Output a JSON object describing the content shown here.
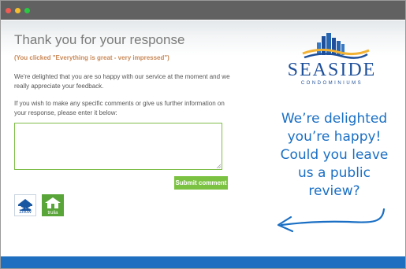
{
  "window": {
    "controls": [
      "close",
      "minimize",
      "maximize"
    ]
  },
  "page": {
    "title": "Thank you for your response",
    "clicked_note": "(You clicked \"Everything is great - very impressed\")",
    "paragraph1": "We're delighted that you are so happy with our service at the moment and we really appreciate your feedback.",
    "paragraph2": "If you wish to make any specific comments or give us further information on your response, please enter it below:",
    "comment_value": "",
    "submit_label": "Submit comment"
  },
  "review_sites": [
    {
      "name": "Zillow",
      "icon": "zillow-icon"
    },
    {
      "name": "trulia",
      "icon": "trulia-icon"
    }
  ],
  "brand": {
    "name": "SEASIDE",
    "subtitle": "CONDOMINIUMS"
  },
  "promo": {
    "line1": "We’re delighted",
    "line2": "you’re happy!",
    "line3": "Could you leave",
    "line4": "us a public review?"
  },
  "colors": {
    "accent_green": "#7cc242",
    "brand_blue": "#1e4f9a",
    "footer_blue": "#1f6fc0",
    "highlight_orange": "#c98856"
  }
}
